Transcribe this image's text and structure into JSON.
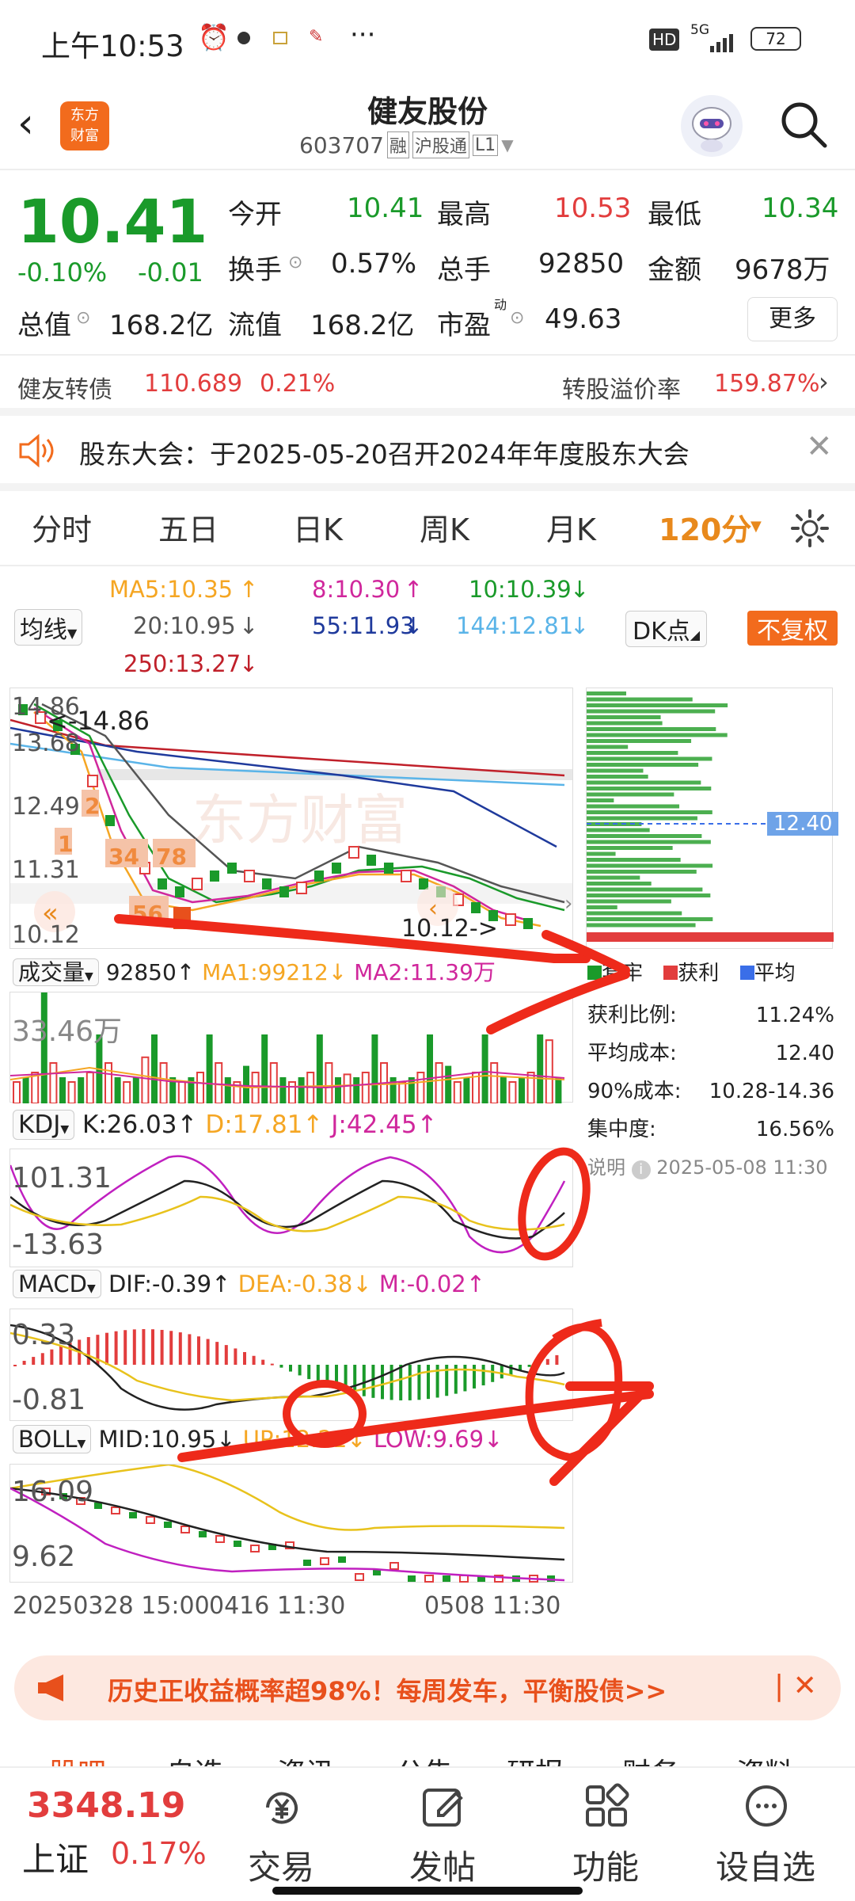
{
  "status": {
    "time": "上午10:53",
    "network": "5G",
    "battery": "72",
    "hd": "HD"
  },
  "header": {
    "logo_line1": "东方",
    "logo_line2": "财富",
    "name": "健友股份",
    "code": "603707",
    "tag_rong": "融",
    "tag_hgt": "沪股通",
    "tag_level": "L1"
  },
  "quote": {
    "price": "10.41",
    "change_pct": "-0.10%",
    "change": "-0.01",
    "open_label": "今开",
    "open": "10.41",
    "high_label": "最高",
    "high": "10.53",
    "low_label": "最低",
    "low": "10.34",
    "turnover_label": "换手",
    "turnover": "0.57%",
    "volume_label": "总手",
    "volume": "92850",
    "amount_label": "金额",
    "amount": "9678万",
    "mktcap_label": "总值",
    "mktcap": "168.2亿",
    "float_label": "流值",
    "float": "168.2亿",
    "pe_label": "市盈",
    "pe_sup": "动",
    "pe": "49.63",
    "more": "更多",
    "bond_label": "健友转债",
    "bond_price": "110.689",
    "bond_pct": "0.21%",
    "premium_label": "转股溢价率",
    "premium": "159.87%"
  },
  "notice": {
    "text": "股东大会：于2025-05-20召开2024年年度股东大会"
  },
  "tabs": [
    "分时",
    "五日",
    "日K",
    "周K",
    "月K",
    "120分"
  ],
  "ma": {
    "selector": "均线",
    "ma5": "MA5:10.35",
    "ma8": "8:10.30",
    "ma10": "10:10.39",
    "ma20": "20:10.95",
    "ma55": "55:11.93",
    "ma144": "144:12.81",
    "ma250": "250:13.27",
    "dk": "DK点",
    "fq": "不复权"
  },
  "kchart": {
    "y_labels": [
      "14.86",
      "13.68",
      "12.49",
      "11.31",
      "10.12"
    ],
    "high_mark": "<-14.86",
    "low_mark": "10.12->",
    "nums": [
      "2",
      "1",
      "34",
      "78",
      "56"
    ],
    "watermark": "东方财富"
  },
  "chip": {
    "avg_tag": "12.40",
    "legend": [
      "套牢",
      "获利",
      "平均"
    ],
    "rows": [
      [
        "获利比例:",
        "11.24%"
      ],
      [
        "平均成本:",
        "12.40"
      ],
      [
        "90%成本:",
        "10.28-14.36"
      ],
      [
        "集中度:",
        "16.56%"
      ]
    ],
    "note_label": "说明",
    "note_time": "2025-05-08 11:30"
  },
  "vol": {
    "selector": "成交量",
    "value": "92850",
    "ma1": "MA1:99212",
    "ma2": "MA2:11.39万",
    "max": "33.46万"
  },
  "kdj": {
    "selector": "KDJ",
    "k": "K:26.03",
    "d": "D:17.81",
    "j": "J:42.45",
    "top": "101.31",
    "bottom": "-13.63"
  },
  "macd": {
    "selector": "MACD",
    "dif": "DIF:-0.39",
    "dea": "DEA:-0.38",
    "m": "M:-0.02",
    "top": "0.33",
    "bottom": "-0.81"
  },
  "boll": {
    "selector": "BOLL",
    "mid": "MID:10.95",
    "up": "UP:12.21",
    "low": "LOW:9.69",
    "top": "16.09",
    "bottom": "9.62"
  },
  "xaxis": {
    "left": "20250328 15:00",
    "mid": "0416 11:30",
    "right": "0508 11:30"
  },
  "promo": {
    "text": "历史正收益概率超98%！每周发车，平衡股债>>"
  },
  "bottom_tabs": [
    "股吧",
    "自选",
    "资讯",
    "公告",
    "研报",
    "财务",
    "资料"
  ],
  "nav": {
    "index_value": "3348.19",
    "index_name": "上证",
    "index_pct": "0.17%",
    "items": [
      "交易",
      "发帖",
      "功能",
      "设自选"
    ]
  },
  "colors": {
    "red": "#e23d3d",
    "green": "#1a9a2a",
    "orange": "#e8891c",
    "accent": "#f26b1d"
  }
}
